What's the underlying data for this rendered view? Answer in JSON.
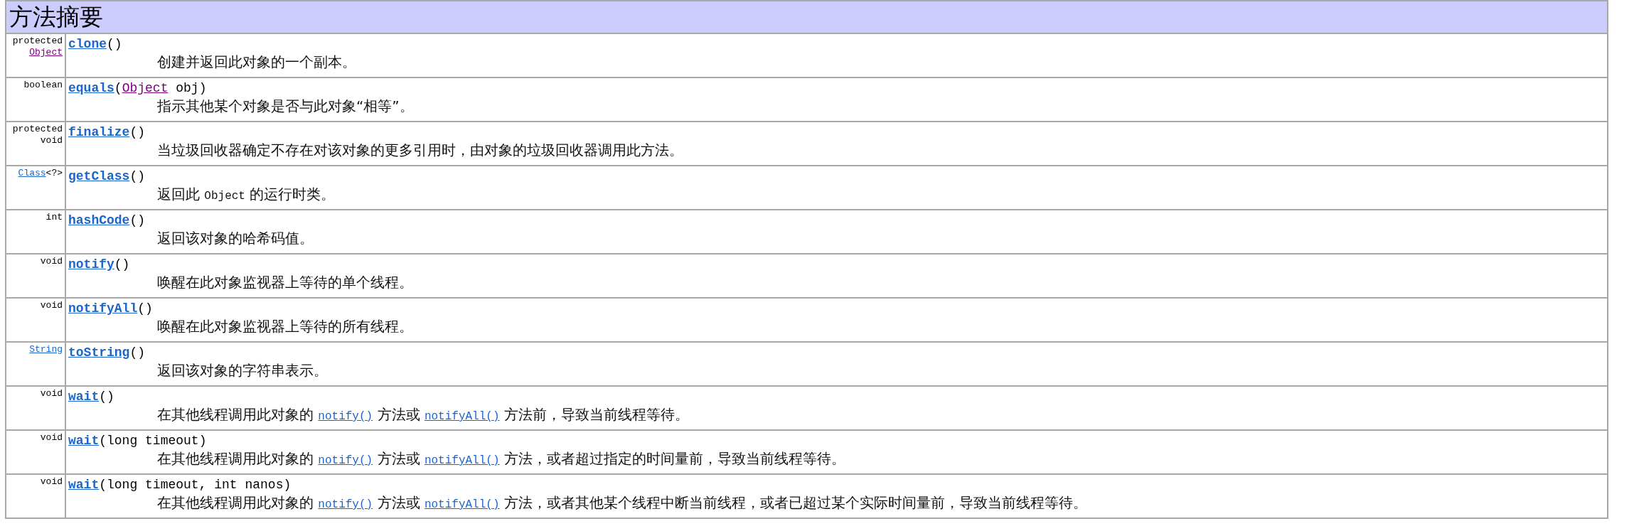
{
  "heading": "方法摘要",
  "methods": [
    {
      "modifier": [
        [
          {
            "kind": "text",
            "text": "protected"
          }
        ],
        [
          {
            "kind": "link",
            "text": "Object",
            "visited": true
          }
        ]
      ],
      "name": "clone",
      "params": [
        {
          "kind": "text",
          "text": "()"
        }
      ],
      "description": [
        {
          "kind": "text",
          "text": "创建并返回此对象的一个副本。"
        }
      ]
    },
    {
      "modifier": [
        [
          {
            "kind": "text",
            "text": "boolean"
          }
        ]
      ],
      "name": "equals",
      "params": [
        {
          "kind": "text",
          "text": "("
        },
        {
          "kind": "link",
          "text": "Object",
          "visited": true
        },
        {
          "kind": "text",
          "text": " obj)"
        }
      ],
      "description": [
        {
          "kind": "text",
          "text": "指示其他某个对象是否与此对象“相等”。"
        }
      ]
    },
    {
      "modifier": [
        [
          {
            "kind": "text",
            "text": "protected"
          }
        ],
        [
          {
            "kind": "text",
            "text": "void"
          }
        ]
      ],
      "name": "finalize",
      "params": [
        {
          "kind": "text",
          "text": "()"
        }
      ],
      "description": [
        {
          "kind": "text",
          "text": "当垃圾回收器确定不存在对该对象的更多引用时，由对象的垃圾回收器调用此方法。"
        }
      ]
    },
    {
      "modifier": [
        [
          {
            "kind": "link",
            "text": "Class",
            "visited": false
          },
          {
            "kind": "text",
            "text": "<?>"
          }
        ]
      ],
      "name": "getClass",
      "params": [
        {
          "kind": "text",
          "text": "()"
        }
      ],
      "description": [
        {
          "kind": "text",
          "text": "返回此 "
        },
        {
          "kind": "code",
          "text": "Object"
        },
        {
          "kind": "text",
          "text": " 的运行时类。"
        }
      ]
    },
    {
      "modifier": [
        [
          {
            "kind": "text",
            "text": "int"
          }
        ]
      ],
      "name": "hashCode",
      "params": [
        {
          "kind": "text",
          "text": "()"
        }
      ],
      "description": [
        {
          "kind": "text",
          "text": "返回该对象的哈希码值。"
        }
      ]
    },
    {
      "modifier": [
        [
          {
            "kind": "text",
            "text": "void"
          }
        ]
      ],
      "name": "notify",
      "params": [
        {
          "kind": "text",
          "text": "()"
        }
      ],
      "description": [
        {
          "kind": "text",
          "text": "唤醒在此对象监视器上等待的单个线程。"
        }
      ]
    },
    {
      "modifier": [
        [
          {
            "kind": "text",
            "text": "void"
          }
        ]
      ],
      "name": "notifyAll",
      "params": [
        {
          "kind": "text",
          "text": "()"
        }
      ],
      "description": [
        {
          "kind": "text",
          "text": "唤醒在此对象监视器上等待的所有线程。"
        }
      ]
    },
    {
      "modifier": [
        [
          {
            "kind": "link",
            "text": "String",
            "visited": false
          }
        ]
      ],
      "name": "toString",
      "params": [
        {
          "kind": "text",
          "text": "()"
        }
      ],
      "description": [
        {
          "kind": "text",
          "text": "返回该对象的字符串表示。"
        }
      ]
    },
    {
      "modifier": [
        [
          {
            "kind": "text",
            "text": "void"
          }
        ]
      ],
      "name": "wait",
      "params": [
        {
          "kind": "text",
          "text": "()"
        }
      ],
      "description": [
        {
          "kind": "text",
          "text": "在其他线程调用此对象的 "
        },
        {
          "kind": "link",
          "text": "notify()",
          "visited": false
        },
        {
          "kind": "text",
          "text": " 方法或 "
        },
        {
          "kind": "link",
          "text": "notifyAll()",
          "visited": false
        },
        {
          "kind": "text",
          "text": " 方法前，导致当前线程等待。"
        }
      ]
    },
    {
      "modifier": [
        [
          {
            "kind": "text",
            "text": "void"
          }
        ]
      ],
      "name": "wait",
      "params": [
        {
          "kind": "text",
          "text": "(long timeout)"
        }
      ],
      "description": [
        {
          "kind": "text",
          "text": "在其他线程调用此对象的 "
        },
        {
          "kind": "link",
          "text": "notify()",
          "visited": false
        },
        {
          "kind": "text",
          "text": " 方法或 "
        },
        {
          "kind": "link",
          "text": "notifyAll()",
          "visited": false
        },
        {
          "kind": "text",
          "text": " 方法，或者超过指定的时间量前，导致当前线程等待。"
        }
      ]
    },
    {
      "modifier": [
        [
          {
            "kind": "text",
            "text": "void"
          }
        ]
      ],
      "name": "wait",
      "params": [
        {
          "kind": "text",
          "text": "(long timeout, int nanos)"
        }
      ],
      "description": [
        {
          "kind": "text",
          "text": "在其他线程调用此对象的 "
        },
        {
          "kind": "link",
          "text": "notify()",
          "visited": false
        },
        {
          "kind": "text",
          "text": " 方法或 "
        },
        {
          "kind": "link",
          "text": "notifyAll()",
          "visited": false
        },
        {
          "kind": "text",
          "text": " 方法，或者其他某个线程中断当前线程，或者已超过某个实际时间量前，导致当前线程等待。"
        }
      ]
    }
  ]
}
